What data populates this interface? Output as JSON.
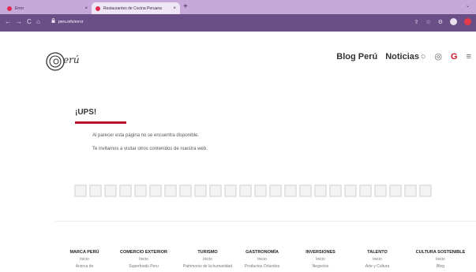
{
  "browser": {
    "tabs": [
      {
        "label": "Error",
        "close": "×"
      },
      {
        "label": "Restaurantes de Cocina Peruana",
        "close": "×"
      }
    ],
    "new_tab": "+",
    "tab_menu": "⌄",
    "url": "peru.info/error",
    "nav": {
      "back": "←",
      "forward": "→",
      "reload": "C",
      "home": "⌂"
    },
    "toolbar_icons": {
      "share": "⇪",
      "star": "☆",
      "ext": "⚙"
    }
  },
  "header": {
    "logo_text": "erú",
    "nav_links": [
      "Blog Perú",
      "Noticias"
    ],
    "icons": {
      "search": "○",
      "globe": "◎",
      "brand": "G",
      "menu": "≡"
    }
  },
  "error": {
    "title": "¡UPS!",
    "line1": "Al parecer esta página no se encuentra disponible.",
    "line2": "Te invitamos a visitar otros contenidos de nuestra web."
  },
  "footer": {
    "columns": [
      {
        "heading": "MARCA PERÚ",
        "links": [
          "Inicio",
          "Acerca de"
        ]
      },
      {
        "heading": "COMERCIO EXTERIOR",
        "links": [
          "Inicio",
          "Superfoods Peru"
        ]
      },
      {
        "heading": "TURISMO",
        "links": [
          "Inicio",
          "Patrimonio de la humanidad"
        ]
      },
      {
        "heading": "GASTRONOMÍA",
        "links": [
          "Inicio",
          "Productos Oriundos"
        ]
      },
      {
        "heading": "INVERSIONES",
        "links": [
          "Inicio",
          "Negocios"
        ]
      },
      {
        "heading": "TALENTO",
        "links": [
          "Inicio",
          "Arte y Cultura"
        ]
      },
      {
        "heading": "CULTURA SOSTENIBLE",
        "links": [
          "Inicio",
          "Blog"
        ]
      }
    ]
  },
  "colors": {
    "accent": "#b8122a",
    "browser_toolbar": "#6a4f86",
    "tabbar": "#c6a9d8"
  }
}
